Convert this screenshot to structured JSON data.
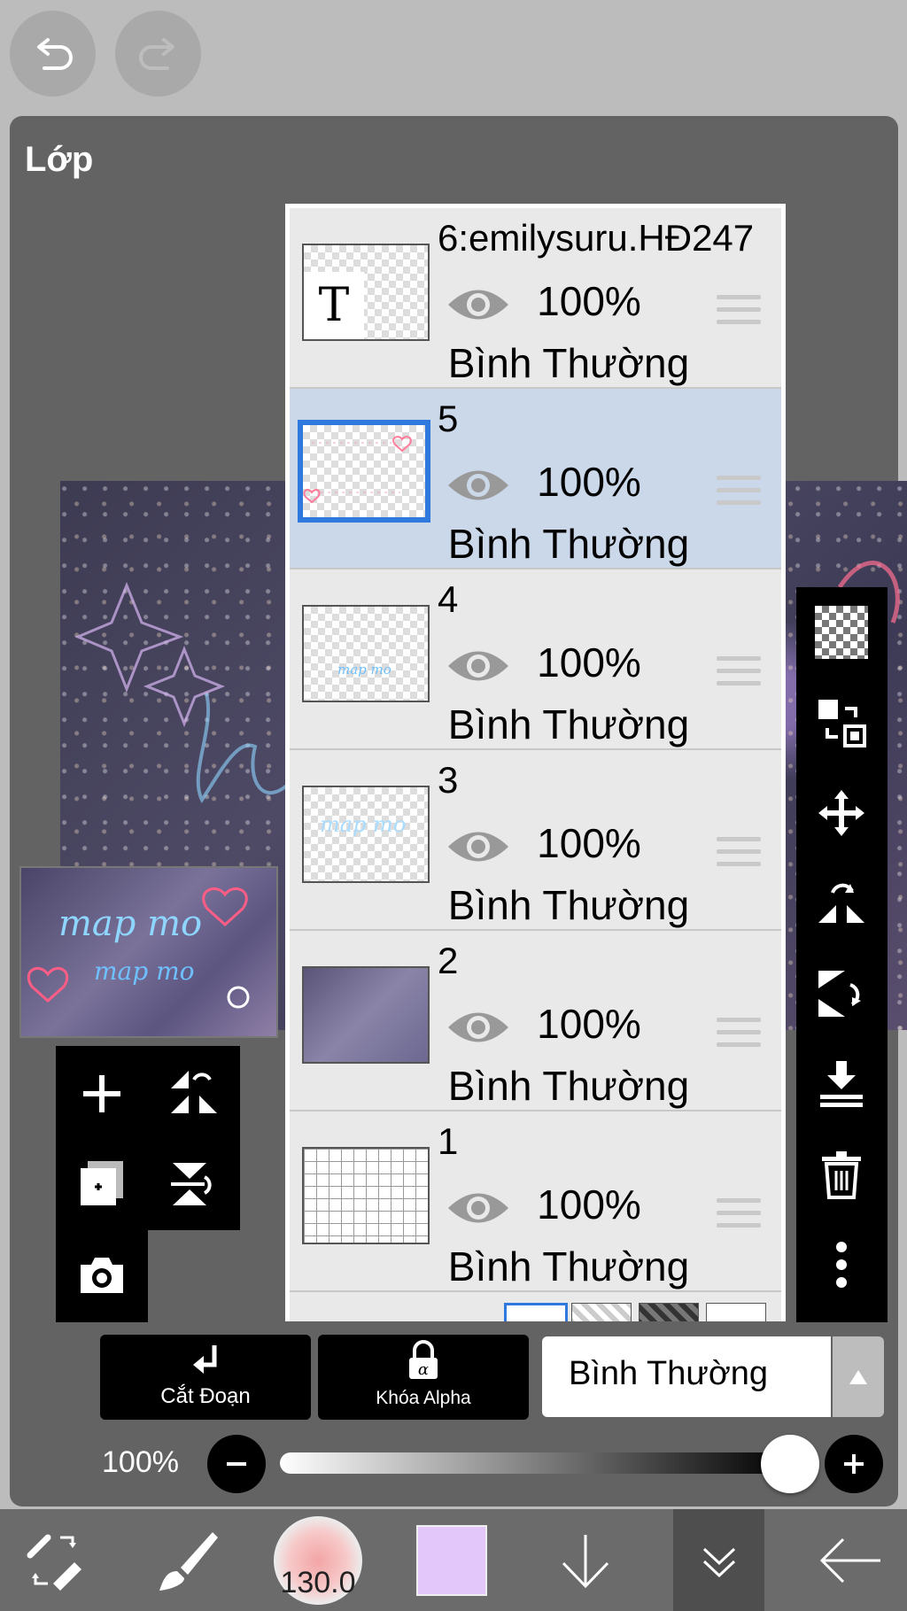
{
  "header": {
    "undo_icon": "undo-icon",
    "redo_icon": "redo-icon"
  },
  "panel": {
    "title": "Lớp"
  },
  "layers": [
    {
      "name": "6:emilysuru.HĐ247",
      "opacity": "100%",
      "mode": "Bình Thường",
      "thumb": "text",
      "selected": false
    },
    {
      "name": "5",
      "opacity": "100%",
      "mode": "Bình Thường",
      "thumb": "transparent",
      "selected": true
    },
    {
      "name": "4",
      "opacity": "100%",
      "mode": "Bình Thường",
      "thumb": "transparent",
      "selected": false
    },
    {
      "name": "3",
      "opacity": "100%",
      "mode": "Bình Thường",
      "thumb": "transparent",
      "selected": false
    },
    {
      "name": "2",
      "opacity": "100%",
      "mode": "Bình Thường",
      "thumb": "photo",
      "selected": false
    },
    {
      "name": "1",
      "opacity": "100%",
      "mode": "Bình Thường",
      "thumb": "grid",
      "selected": false
    }
  ],
  "thumb_text": {
    "layer6_glyph": "T",
    "layer4_text": "map mo",
    "layer3_text": "map mo"
  },
  "preview": {
    "line1": "map mo",
    "line2": "map mo"
  },
  "buttons": {
    "clip_label": "Cắt Đoạn",
    "alpha_label": "Khóa Alpha"
  },
  "blend": {
    "value": "Bình Thường"
  },
  "opacity": {
    "label": "100%",
    "value": 1.0
  },
  "brush": {
    "size": "130.0"
  },
  "colors": {
    "current": "#e3c7fb",
    "accent": "#2f78dd",
    "selected_row": "#cbd8ea"
  }
}
